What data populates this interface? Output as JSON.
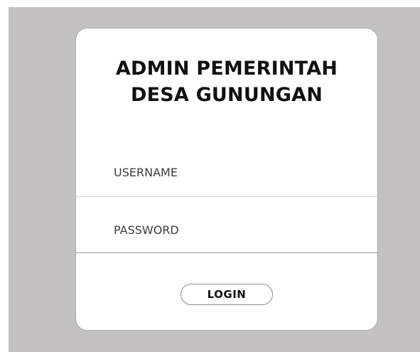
{
  "login_card": {
    "title_line1": "ADMIN PEMERINTAH",
    "title_line2": "DESA GUNUNGAN",
    "username_placeholder": "USERNAME",
    "password_placeholder": "PASSWORD",
    "login_label": "LOGIN"
  },
  "colors": {
    "backdrop": "#c3c2c0",
    "card": "#ffffff",
    "text": "#111111"
  }
}
